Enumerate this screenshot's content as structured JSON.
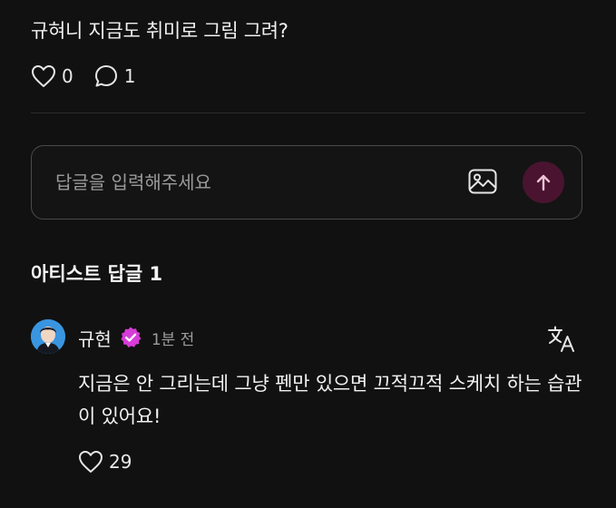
{
  "post": {
    "text": "규혀니 지금도 취미로 그림 그려?",
    "likes": "0",
    "comments": "1",
    "like_icon": "heart-outline",
    "comment_icon": "speech-bubble-outline"
  },
  "reply": {
    "placeholder": "답글을 입력해주세요",
    "image_icon": "image",
    "send_icon": "arrow-up",
    "send_color": "#4a1430"
  },
  "artist_replies": {
    "title": "아티스트 답글 1",
    "comments": [
      {
        "author": "규현",
        "verified_icon": "verified-badge",
        "verified_color": "#d63cd8",
        "time": "1분 전",
        "text": "지금은 안 그리는데 그냥 펜만 있으면 끄적끄적 스케치 하는 습관이 있어요!",
        "likes": "29",
        "translate_icon": "translate"
      }
    ]
  }
}
